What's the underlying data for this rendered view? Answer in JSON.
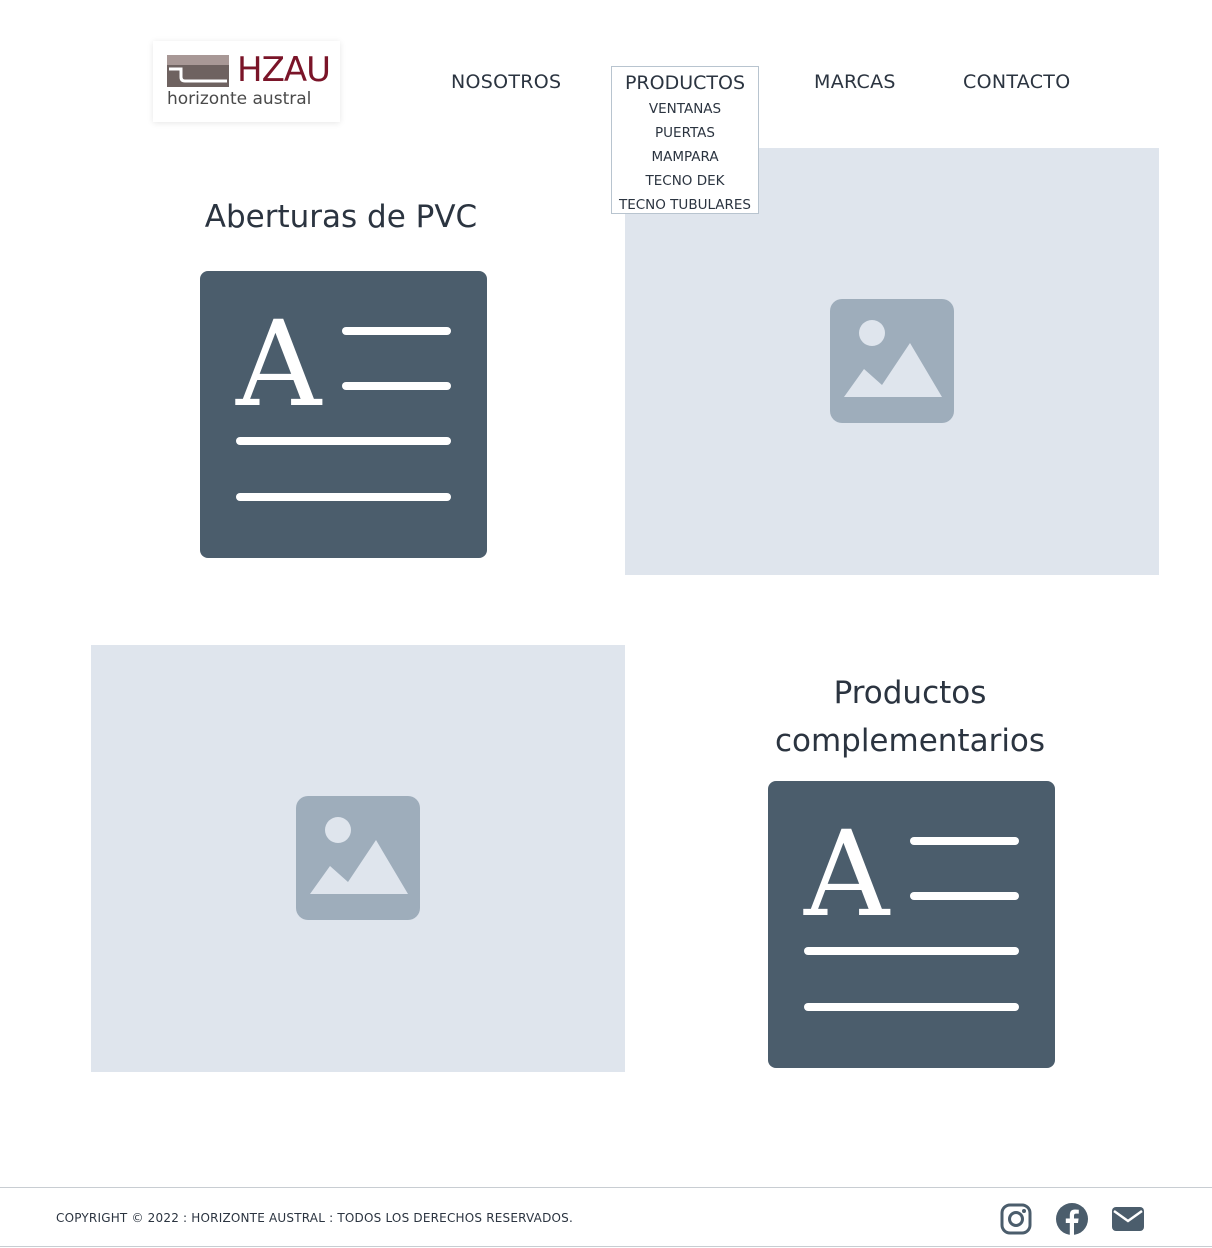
{
  "logo": {
    "mark_text": "HZAU",
    "tagline": "horizonte austral"
  },
  "nav": {
    "items": [
      "NOSOTROS",
      "PRODUCTOS",
      "MARCAS",
      "CONTACTO"
    ],
    "dropdown": {
      "title": "PRODUCTOS",
      "items": [
        "VENTANAS",
        "PUERTAS",
        "MAMPARA",
        "TECNO DEK",
        "TECNO TUBULARES"
      ]
    }
  },
  "sections": [
    {
      "heading": "Aberturas de PVC"
    },
    {
      "heading_line1": "Productos",
      "heading_line2": "complementarios"
    }
  ],
  "footer": {
    "copyright": "COPYRIGHT © 2022 : HORIZONTE AUSTRAL : TODOS LOS DERECHOS RESERVADOS.",
    "social": [
      "instagram-icon",
      "facebook-icon",
      "mail-icon"
    ]
  },
  "colors": {
    "brand": "#7a1428",
    "text": "#2b3440",
    "placeholder_bg": "#dfe5ed",
    "placeholder_icon": "#9eadbb",
    "text_block": "#4b5d6c"
  }
}
